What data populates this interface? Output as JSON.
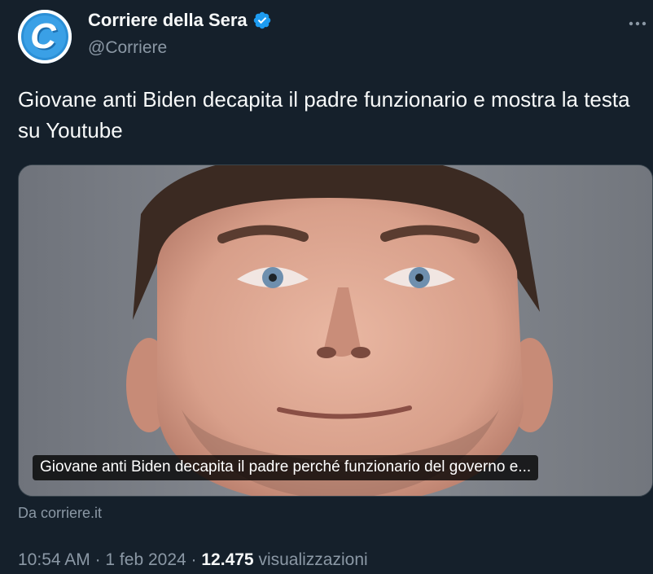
{
  "account": {
    "display_name": "Corriere della Sera",
    "handle": "@Corriere",
    "avatar_letter": "C",
    "verified_icon": "verified-badge-icon"
  },
  "tweet": {
    "text": "Giovane anti Biden decapita il padre funzionario e mostra la testa su Youtube"
  },
  "card": {
    "caption": "Giovane anti Biden decapita il padre perché funzionario del governo e...",
    "source": "Da corriere.it"
  },
  "meta": {
    "time": "10:54 AM",
    "separator": "·",
    "date": "1 feb 2024",
    "views_count": "12.475",
    "views_label": "visualizzazioni"
  },
  "colors": {
    "background": "#15202b",
    "text_primary": "#f7f9f9",
    "text_secondary": "#8b98a5",
    "verified_blue": "#1d9bf0",
    "avatar_blue": "#3aa0e6"
  }
}
